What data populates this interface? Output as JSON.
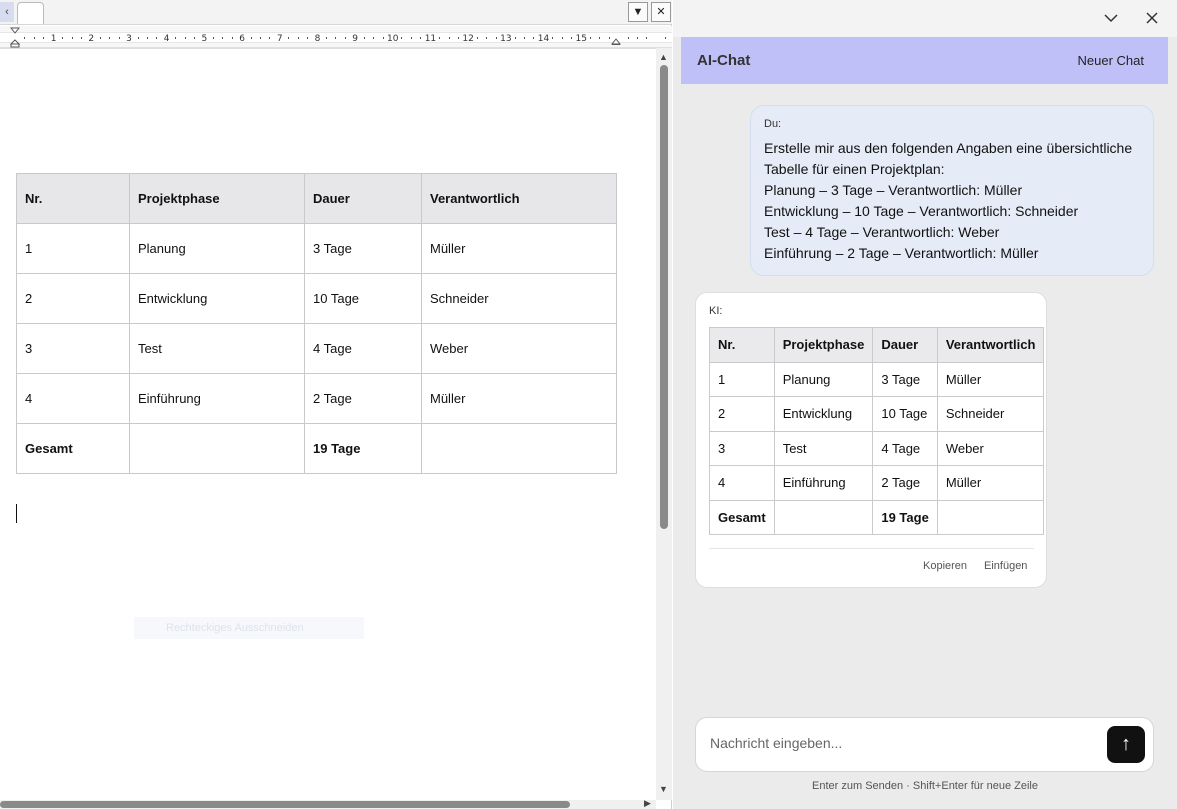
{
  "editor": {
    "tab_close_symbol": "✕",
    "tab_dropdown_symbol": "▼",
    "ruler_numbers": [
      "1",
      "2",
      "3",
      "4",
      "5",
      "6",
      "7",
      "8",
      "9",
      "10",
      "11",
      "12",
      "13",
      "14",
      "15"
    ],
    "table": {
      "headers": [
        "Nr.",
        "Projektphase",
        "Dauer",
        "Verantwortlich"
      ],
      "rows": [
        [
          "1",
          "Planung",
          "3 Tage",
          "Müller"
        ],
        [
          "2",
          "Entwicklung",
          "10 Tage",
          "Schneider"
        ],
        [
          "3",
          "Test",
          "4 Tage",
          "Weber"
        ],
        [
          "4",
          "Einführung",
          "2 Tage",
          "Müller"
        ]
      ],
      "total": [
        "Gesamt",
        "",
        "19 Tage",
        ""
      ]
    },
    "ghost_tooltip": "Rechteckiges Ausschneiden"
  },
  "chat": {
    "title": "AI-Chat",
    "new_chat_label": "Neuer Chat",
    "user_message": {
      "sender": "Du:",
      "lines": [
        "Erstelle mir aus den folgenden Angaben eine übersichtliche",
        "Tabelle für einen Projektplan:",
        "Planung – 3 Tage – Verantwortlich: Müller",
        "Entwicklung – 10 Tage – Verantwortlich: Schneider",
        "Test – 4 Tage – Verantwortlich: Weber",
        "Einführung – 2 Tage – Verantwortlich: Müller"
      ]
    },
    "ai_message": {
      "sender": "KI:",
      "table": {
        "headers": [
          "Nr.",
          "Projektphase",
          "Dauer",
          "Verantwortlich"
        ],
        "rows": [
          [
            "1",
            "Planung",
            "3 Tage",
            "Müller"
          ],
          [
            "2",
            "Entwicklung",
            "10 Tage",
            "Schneider"
          ],
          [
            "3",
            "Test",
            "4 Tage",
            "Weber"
          ],
          [
            "4",
            "Einführung",
            "2 Tage",
            "Müller"
          ]
        ],
        "total": [
          "Gesamt",
          "",
          "19 Tage",
          ""
        ]
      },
      "copy_label": "Kopieren",
      "insert_label": "Einfügen"
    },
    "input_placeholder": "Nachricht eingeben...",
    "send_symbol": "↑",
    "hint": "Enter zum Senden · Shift+Enter für neue Zeile",
    "colors": {
      "header_bg": "#c0c0f8",
      "user_bubble_bg": "#e5ebf7",
      "send_button": "#111111"
    }
  }
}
